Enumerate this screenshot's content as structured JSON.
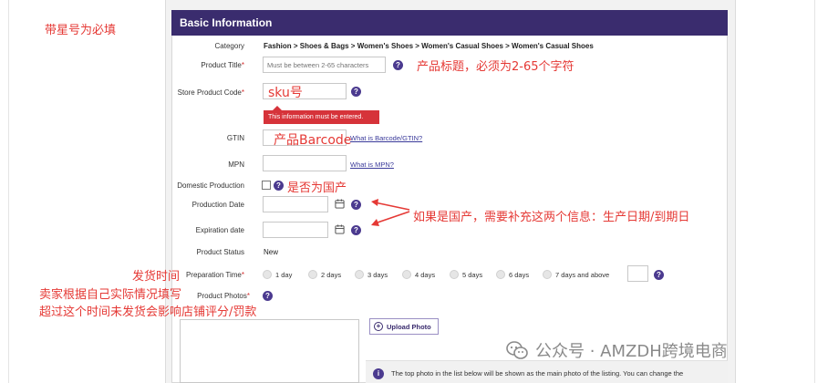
{
  "annotations": {
    "required_note": "带星号为必填",
    "title_note": "产品标题，必须为2-65个字符",
    "sku_note": "sku号",
    "barcode_note": "产品Barcode",
    "domestic_note": "是否为国产",
    "dates_note": "如果是国产，需要补充这两个信息：生产日期/到期日",
    "shipping_line1": "发货时间",
    "shipping_line2": "卖家根据自己实际情况填写",
    "shipping_line3": "超过这个时间未发货会影响店铺评分/罚款"
  },
  "header": {
    "title": "Basic Information"
  },
  "fields": {
    "category_label": "Category",
    "category_value": "Fashion > Shoes & Bags > Women's Shoes > Women's Casual Shoes > Women's Casual Shoes",
    "title_label": "Product Title",
    "title_placeholder": "Must be between 2-65 characters",
    "sku_label": "Store Product Code",
    "sku_error": "This information must be entered.",
    "gtin_label": "GTIN",
    "gtin_link": "What is Barcode/GTIN?",
    "mpn_label": "MPN",
    "mpn_link": "What is MPN?",
    "domestic_label": "Domestic Production",
    "production_date_label": "Production Date",
    "expiration_date_label": "Expiration date",
    "status_label": "Product Status",
    "status_value": "New",
    "prep_label": "Preparation Time",
    "prep_options": [
      "1 day",
      "2 days",
      "3 days",
      "4 days",
      "5 days",
      "6 days",
      "7 days and above"
    ],
    "photos_label": "Product Photos",
    "upload_label": "Upload Photo",
    "photo_info": "The top photo in the list below will be shown as the main photo of the listing. You can change the"
  },
  "required_mark": "*",
  "help_glyph": "?",
  "watermark": {
    "text": "公众号 · AMZDH跨境电商"
  },
  "colors": {
    "header": "#3a2c6e",
    "annotation": "#e53935",
    "error": "#d6333a",
    "help": "#4b3a8f"
  }
}
